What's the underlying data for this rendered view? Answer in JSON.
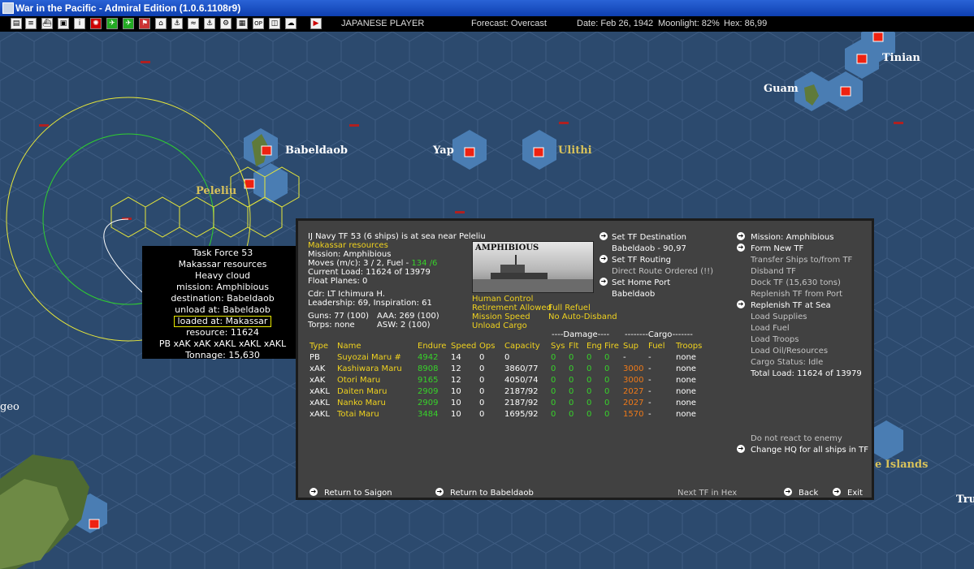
{
  "window": {
    "title": "War in the Pacific - Admiral Edition (1.0.6.1108r9)"
  },
  "status_bar": {
    "player": "JAPANESE PLAYER",
    "forecast": "Forecast: Overcast",
    "date": "Date: Feb 26, 1942",
    "moonlight": "Moonlight: 82%",
    "hex": "Hex: 86,99"
  },
  "toolbar_icons": [
    "report-icon",
    "list-icon",
    "ship-icon",
    "base-icon",
    "info-icon",
    "flag-icon",
    "aircraft-icon",
    "plane-icon",
    "flag-icon",
    "tank-icon",
    "fleet-icon",
    "sub-icon",
    "convoy-icon",
    "settings-icon",
    "op-icon",
    "db-icon",
    "weather-icon",
    "play-icon"
  ],
  "map_labels": {
    "babeldaob": "Babeldaob",
    "peleliu": "Peleliu",
    "yap": "Yap",
    "ulithi": "Ulithi",
    "guam": "Guam",
    "tinian": "Tinian",
    "islands": "e Islands",
    "geo": "geo",
    "tru": "Tru"
  },
  "popup": {
    "lines": [
      "Task Force 53",
      "Makassar resources",
      "Heavy cloud",
      "mission: Amphibious",
      "destination: Babeldaob",
      "unload at: Babeldaob"
    ],
    "loaded_at": "loaded at: Makassar",
    "lines2": [
      "resource: 11624",
      "PB xAK xAK xAKL xAKL xAKL",
      "Tonnage: 15,630"
    ]
  },
  "tf": {
    "header": "IJ Navy TF 53 (6 ships) is at sea near Peleliu",
    "name": "Makassar resources",
    "mission": "Mission: Amphibious",
    "moves_prefix": "Moves (m/c): 3 / 2, Fuel - ",
    "fuel": "134 /6",
    "current_load": "Current Load: 11624 of 13979",
    "float_planes": "Float Planes: 0",
    "cdr": "Cdr: LT Ichimura H.",
    "leadership": "Leadership: 69, Inspiration: 61",
    "guns": "Guns: 77 (100)",
    "aaa": "AAA: 269 (100)",
    "torps": "Torps: none",
    "asw": "ASW: 2 (100)",
    "photo_label": "AMPHIBIOUS",
    "flags": [
      "Human Control",
      "Retirement Allowed",
      "Mission Speed",
      "Unload Cargo"
    ],
    "flags2": [
      "Full Refuel",
      "No Auto-Disband"
    ]
  },
  "middle_actions": {
    "set_destination": "Set TF Destination",
    "destination_value": "Babeldaob - 90,97",
    "set_routing": "Set TF Routing",
    "routing_value": "Direct Route Ordered (!!)",
    "set_home_port": "Set Home Port",
    "home_port_value": "Babeldaob"
  },
  "right_actions": {
    "mission": "Mission: Amphibious",
    "form_new_tf": "Form New TF",
    "transfer": "Transfer Ships to/from TF",
    "disband": "Disband TF",
    "dock": "Dock TF (15,630 tons)",
    "replenish_port": "Replenish TF from Port",
    "replenish_sea": "Replenish TF at Sea",
    "load_supplies": "Load Supplies",
    "load_fuel": "Load Fuel",
    "load_troops": "Load Troops",
    "load_oil": "Load Oil/Resources",
    "cargo_status": "Cargo Status: Idle",
    "total_load": "Total Load: 11624 of 13979",
    "do_not_react": "Do not react to enemy",
    "change_hq": "Change HQ for all ships in TF"
  },
  "table": {
    "group_damage": "----Damage----",
    "group_cargo": "--------Cargo-------",
    "headers": [
      "Type",
      "Name",
      "Endure",
      "Speed",
      "Ops",
      "Capacity",
      "Sys",
      "Flt",
      "Eng",
      "Fire",
      "Sup",
      "Fuel",
      "Troops"
    ],
    "rows": [
      [
        "PB",
        "Suyozai Maru #",
        "4942",
        "14",
        "0",
        "0",
        "0",
        "0",
        "0",
        "0",
        "-",
        "-",
        "none"
      ],
      [
        "xAK",
        "Kashiwara Maru",
        "8908",
        "12",
        "0",
        "3860/77",
        "0",
        "0",
        "0",
        "0",
        "3000",
        "-",
        "none"
      ],
      [
        "xAK",
        "Otori Maru",
        "9165",
        "12",
        "0",
        "4050/74",
        "0",
        "0",
        "0",
        "0",
        "3000",
        "-",
        "none"
      ],
      [
        "xAKL",
        "Daiten Maru",
        "2909",
        "10",
        "0",
        "2187/92",
        "0",
        "0",
        "0",
        "0",
        "2027",
        "-",
        "none"
      ],
      [
        "xAKL",
        "Nanko Maru",
        "2909",
        "10",
        "0",
        "2187/92",
        "0",
        "0",
        "0",
        "0",
        "2027",
        "-",
        "none"
      ],
      [
        "xAKL",
        "Totai Maru",
        "3484",
        "10",
        "0",
        "1695/92",
        "0",
        "0",
        "0",
        "0",
        "1570",
        "-",
        "none"
      ]
    ]
  },
  "footer": {
    "return_saigon": "Return to Saigon",
    "return_babeldaob": "Return to Babeldaob",
    "next_tf": "Next TF in Hex",
    "back": "Back",
    "exit": "Exit"
  },
  "colors": {
    "panel_bg": "#414141",
    "yellow_text": "#f0d21e",
    "green_text": "#37d22a",
    "orange_text": "#f07a18",
    "sea": "#2c4a6e"
  }
}
